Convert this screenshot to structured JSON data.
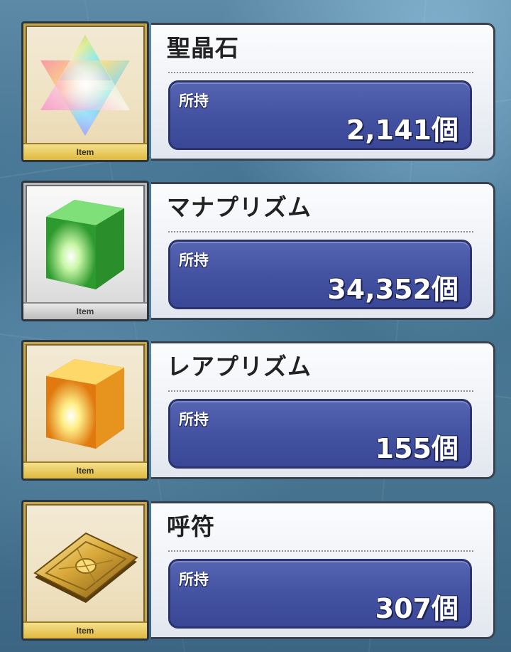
{
  "items": [
    {
      "name": "聖晶石",
      "tag": "Item",
      "owned_label": "所持",
      "owned_value": "2,141個",
      "icon": "saint-quartz-icon",
      "frame": "gold"
    },
    {
      "name": "マナプリズム",
      "tag": "Item",
      "owned_label": "所持",
      "owned_value": "34,352個",
      "icon": "mana-prism-icon",
      "frame": "silver"
    },
    {
      "name": "レアプリズム",
      "tag": "Item",
      "owned_label": "所持",
      "owned_value": "155個",
      "icon": "rare-prism-icon",
      "frame": "gold"
    },
    {
      "name": "呼符",
      "tag": "Item",
      "owned_label": "所持",
      "owned_value": "307個",
      "icon": "summon-ticket-icon",
      "frame": "gold"
    }
  ],
  "colors": {
    "owned_box": "#4452a2",
    "gold_frame": "#c8a44a",
    "silver_frame": "#b8b8b8"
  }
}
